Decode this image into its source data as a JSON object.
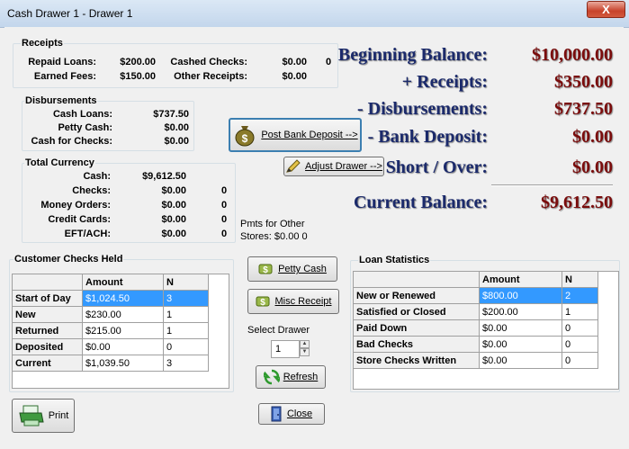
{
  "window": {
    "title": "Cash Drawer 1 - Drawer 1",
    "close_label": "X"
  },
  "receipts": {
    "legend": "Receipts",
    "repaid_loans_label": "Repaid Loans:",
    "repaid_loans_value": "$200.00",
    "earned_fees_label": "Earned Fees:",
    "earned_fees_value": "$150.00",
    "cashed_checks_label": "Cashed Checks:",
    "cashed_checks_value": "$0.00",
    "cashed_checks_count": "0",
    "other_receipts_label": "Other Receipts:",
    "other_receipts_value": "$0.00"
  },
  "disbursements": {
    "legend": "Disbursements",
    "cash_loans_label": "Cash Loans:",
    "cash_loans_value": "$737.50",
    "petty_cash_label": "Petty Cash:",
    "petty_cash_value": "$0.00",
    "cash_for_checks_label": "Cash for Checks:",
    "cash_for_checks_value": "$0.00"
  },
  "total_currency": {
    "legend": "Total Currency",
    "cash_label": "Cash:",
    "cash_value": "$9,612.50",
    "checks_label": "Checks:",
    "checks_value": "$0.00",
    "checks_count": "0",
    "money_orders_label": "Money Orders:",
    "money_orders_value": "$0.00",
    "money_orders_count": "0",
    "credit_cards_label": "Credit Cards:",
    "credit_cards_value": "$0.00",
    "credit_cards_count": "0",
    "eft_ach_label": "EFT/ACH:",
    "eft_ach_value": "$0.00",
    "eft_ach_count": "0"
  },
  "other_stores": {
    "line1": "Pmts for Other",
    "line2": "Stores: $0.00  0"
  },
  "summary": {
    "beginning_label": "Beginning Balance:",
    "beginning_value": "$10,000.00",
    "receipts_label": "+ Receipts:",
    "receipts_value": "$350.00",
    "disbursements_label": "- Disbursements:",
    "disbursements_value": "$737.50",
    "bank_deposit_label": "- Bank Deposit:",
    "bank_deposit_value": "$0.00",
    "short_over_label": "Short / Over:",
    "short_over_value": "$0.00",
    "current_label": "Current Balance:",
    "current_value": "$9,612.50"
  },
  "buttons": {
    "post_bank_deposit": "Post Bank Deposit -->",
    "adjust_drawer": "Adjust Drawer -->",
    "petty_cash": "Petty Cash",
    "misc_receipt": "Misc Receipt",
    "refresh": "Refresh",
    "close": "Close",
    "print": "Print"
  },
  "select_drawer": {
    "label": "Select Drawer",
    "value": "1"
  },
  "customer_checks": {
    "legend": "Customer Checks Held",
    "headers": [
      "",
      "Amount",
      "N"
    ],
    "rows": [
      {
        "label": "Start of Day",
        "amount": "$1,024.50",
        "n": "3"
      },
      {
        "label": "New",
        "amount": "$230.00",
        "n": "1"
      },
      {
        "label": "Returned",
        "amount": "$215.00",
        "n": "1"
      },
      {
        "label": "Deposited",
        "amount": "$0.00",
        "n": "0"
      },
      {
        "label": "Current",
        "amount": "$1,039.50",
        "n": "3"
      }
    ]
  },
  "loan_statistics": {
    "legend": "Loan Statistics",
    "headers": [
      "",
      "Amount",
      "N"
    ],
    "rows": [
      {
        "label": "New or Renewed",
        "amount": "$800.00",
        "n": "2"
      },
      {
        "label": "Satisfied or Closed",
        "amount": "$200.00",
        "n": "1"
      },
      {
        "label": "Paid Down",
        "amount": "$0.00",
        "n": "0"
      },
      {
        "label": "Bad Checks",
        "amount": "$0.00",
        "n": "0"
      },
      {
        "label": "Store Checks Written",
        "amount": "$0.00",
        "n": "0"
      }
    ]
  },
  "icons": {
    "money_bag": "money-bag-icon",
    "pencil": "pencil-icon",
    "dollar": "dollar-icon",
    "refresh": "refresh-icon",
    "close": "exit-door-icon",
    "printer": "printer-icon"
  },
  "colors": {
    "navy": "#1b2a6b",
    "maroon": "#7a0c0c",
    "selection": "#3399ff"
  }
}
